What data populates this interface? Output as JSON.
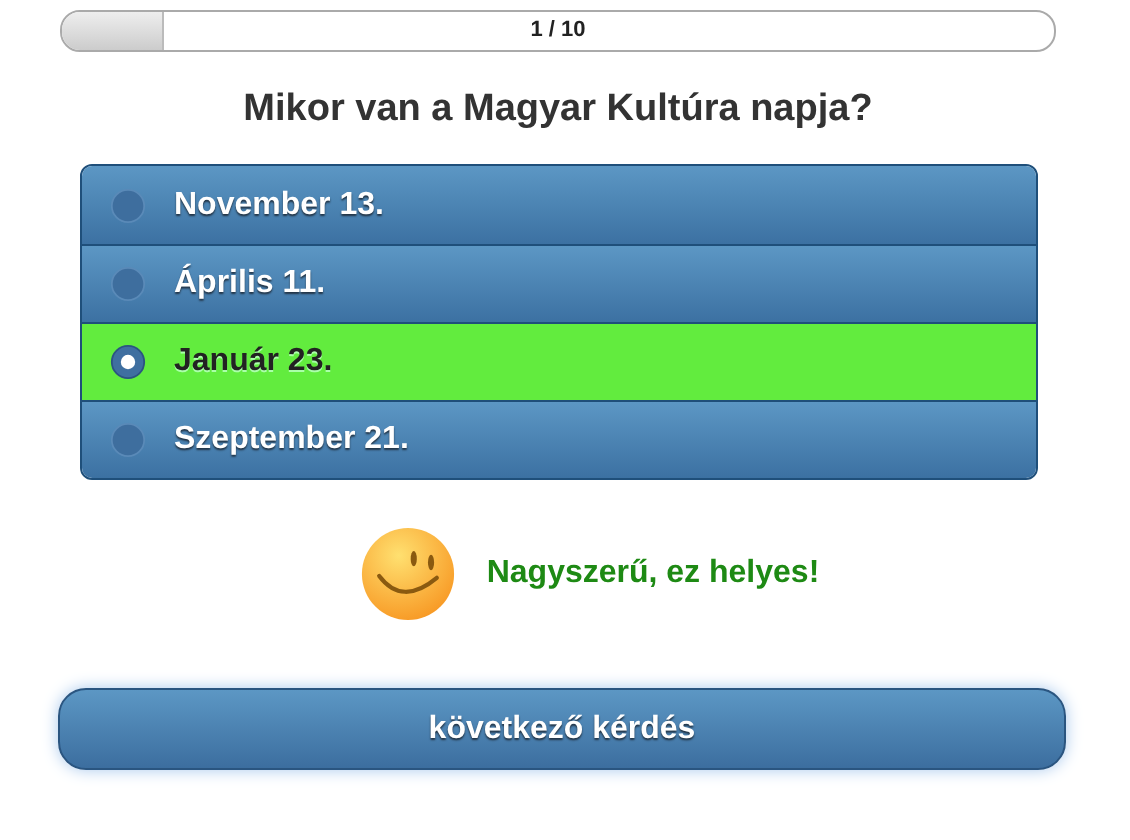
{
  "progress": {
    "label": "1 / 10",
    "level": 0.1
  },
  "question": "Mikor van a Magyar Kultúra napja?",
  "options": [
    {
      "label": "November 13.",
      "selected": false
    },
    {
      "label": "Április 11.",
      "selected": false
    },
    {
      "label": "Január 23.",
      "selected": true
    },
    {
      "label": "Szeptember 21.",
      "selected": false
    }
  ],
  "feedback": {
    "kind": "correct",
    "text": "Nagyszerű, ez helyes!"
  },
  "next_button": "következő kérdés"
}
